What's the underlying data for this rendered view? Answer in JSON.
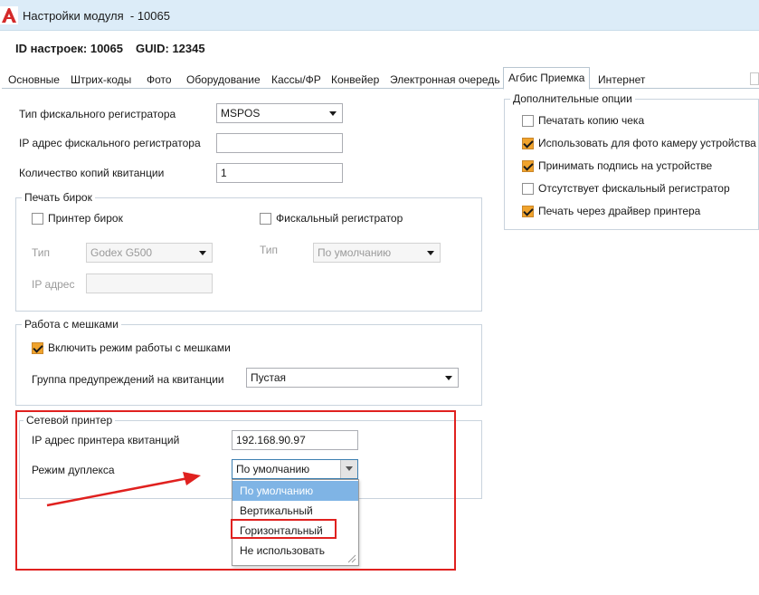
{
  "window": {
    "title": "Настройки модуля  - 10065"
  },
  "header": {
    "id_label": "ID настроек: 10065",
    "guid_label": "GUID: 12345"
  },
  "tabs": [
    {
      "label": "Основные"
    },
    {
      "label": "Штрих-коды"
    },
    {
      "label": "Фото"
    },
    {
      "label": "Оборудование"
    },
    {
      "label": "Кассы/ФР"
    },
    {
      "label": "Конвейер"
    },
    {
      "label": "Электронная очередь"
    },
    {
      "label": "Агбис Приемка",
      "active": true
    },
    {
      "label": "Интернет"
    }
  ],
  "fiscal": {
    "type_label": "Тип фискального регистратора",
    "type_value": "MSPOS",
    "ip_label": "IP адрес фискального регистратора",
    "ip_value": "",
    "copies_label": "Количество копий квитанции",
    "copies_value": "1"
  },
  "tag_printing": {
    "title": "Печать бирок",
    "tag_printer_label": "Принтер бирок",
    "fiscal_registrar_label": "Фискальный регистратор",
    "type_label": "Тип",
    "type_value": "Godex G500",
    "type2_label": "Тип",
    "type2_value": "По умолчанию",
    "ip_label": "IP адрес",
    "ip_value": ""
  },
  "bags": {
    "title": "Работа с мешками",
    "enable_label": "Включить режим работы с мешками",
    "warnings_label": "Группа предупреждений на квитанции",
    "warnings_value": "Пустая"
  },
  "network_printer": {
    "title": "Сетевой принтер",
    "ip_label": "IP адрес принтера квитанций",
    "ip_value": "192.168.90.97",
    "duplex_label": "Режим дуплекса",
    "duplex_value": "По умолчанию",
    "duplex_options": [
      "По умолчанию",
      "Вертикальный",
      "Горизонтальный",
      "Не использовать"
    ]
  },
  "extra_options": {
    "title": "Дополнительные опции",
    "items": [
      {
        "label": "Печатать копию чека",
        "checked": false
      },
      {
        "label": "Использовать для фото камеру устройства",
        "checked": true
      },
      {
        "label": "Принимать подпись на устройстве",
        "checked": true
      },
      {
        "label": "Отсутствует фискальный регистратор",
        "checked": false
      },
      {
        "label": "Печать через драйвер принтера",
        "checked": true
      }
    ]
  },
  "colors": {
    "annotation_red": "#e0211f",
    "checkbox_checked": "#f0a32c",
    "selection_blue": "#7fb4e5",
    "titlebar_bg": "#dcecf8"
  },
  "icons": {
    "app": "app-logo-icon",
    "dropdown": "chevron-down-icon",
    "annotation": "red-arrow-annotation"
  }
}
